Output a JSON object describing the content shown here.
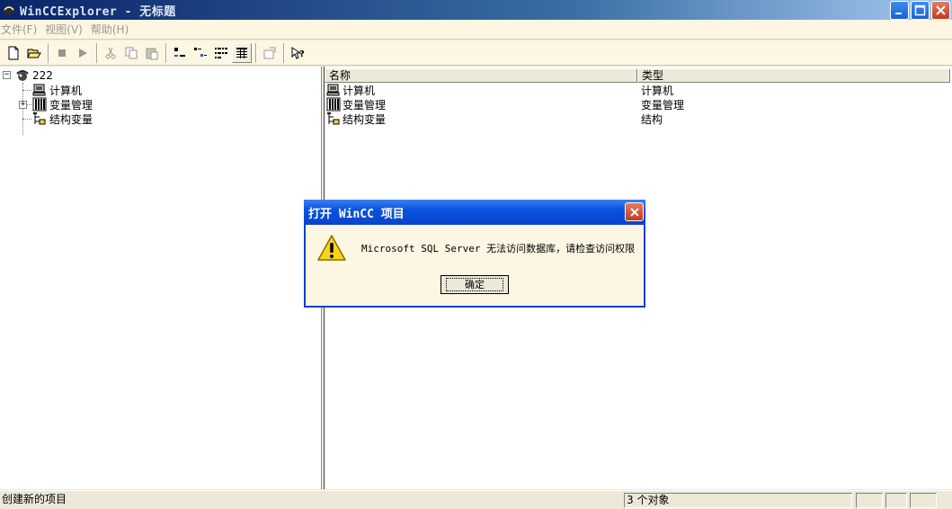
{
  "window": {
    "title": "WinCCExplorer - 无标题",
    "icon": "wincc-app-icon"
  },
  "menu": {
    "items": [
      "文件(F)",
      "视图(V)",
      "帮助(H)"
    ]
  },
  "toolbar": {
    "buttons": [
      "new-icon",
      "open-icon",
      "stop-icon",
      "run-icon",
      "cut-icon",
      "copy-icon",
      "paste-icon",
      "large-icons-icon",
      "small-icons-icon",
      "list-view-icon",
      "details-view-icon",
      "properties-icon",
      "help-icon"
    ]
  },
  "tree": {
    "root": {
      "label": "222",
      "icon": "project-globe-icon"
    },
    "children": [
      {
        "label": "计算机",
        "icon": "computer-icon"
      },
      {
        "label": "变量管理",
        "icon": "tag-management-icon"
      },
      {
        "label": "结构变量",
        "icon": "structure-tag-icon"
      }
    ]
  },
  "list": {
    "columns": [
      "名称",
      "类型"
    ],
    "rows": [
      {
        "name": "计算机",
        "type": "计算机",
        "icon": "computer-icon"
      },
      {
        "name": "变量管理",
        "type": "变量管理",
        "icon": "tag-management-icon"
      },
      {
        "name": "结构变量",
        "type": "结构",
        "icon": "structure-tag-icon"
      }
    ]
  },
  "statusbar": {
    "message": "创建新的项目",
    "count": "3 个对象"
  },
  "dialog": {
    "title": "打开 WinCC 项目",
    "message": "Microsoft SQL Server 无法访问数据库，请检查访问权限",
    "ok_label": "确定",
    "icon": "warning-icon"
  },
  "colors": {
    "titlebar": "#0a246a",
    "dialog_title": "#0a52e0",
    "face": "#ece9d8",
    "menu_bg": "#fdf6e3"
  }
}
